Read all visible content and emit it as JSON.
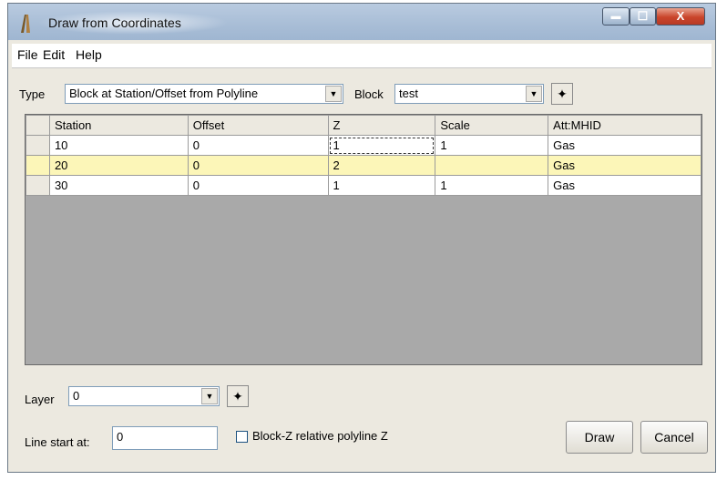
{
  "window": {
    "title": "Draw from Coordinates",
    "minimize_glyph": "▬",
    "maximize_glyph": "☐",
    "close_glyph": "X"
  },
  "menu": {
    "items": [
      "File",
      "Edit",
      "Help"
    ]
  },
  "type_row": {
    "label": "Type",
    "value": "Block at Station/Offset from Polyline",
    "block_label": "Block",
    "block_value": "test"
  },
  "grid": {
    "columns": [
      "Station",
      "Offset",
      "Z",
      "Scale",
      "Att:MHID"
    ],
    "rows": [
      [
        "10",
        "0",
        "1",
        "1",
        "Gas"
      ],
      [
        "20",
        "0",
        "2",
        "",
        "Gas"
      ],
      [
        "30",
        "0",
        "1",
        "1",
        "Gas"
      ]
    ]
  },
  "layer": {
    "label": "Layer",
    "value": "0"
  },
  "line_start": {
    "label": "Line start at:",
    "value": "0"
  },
  "checkbox": {
    "label": "Block-Z relative polyline Z",
    "checked": false
  },
  "buttons": {
    "draw": "Draw",
    "cancel": "Cancel"
  },
  "icons": {
    "app": "survey-app-icon",
    "pick": "crosshair-pick-icon",
    "dropdown": "dropdown-arrow-icon"
  },
  "colors": {
    "selected_row": "#fcf6b8",
    "grid_background": "#a9a9a9",
    "titlebar": "#a8bdd6",
    "close_button": "#c9452b"
  }
}
